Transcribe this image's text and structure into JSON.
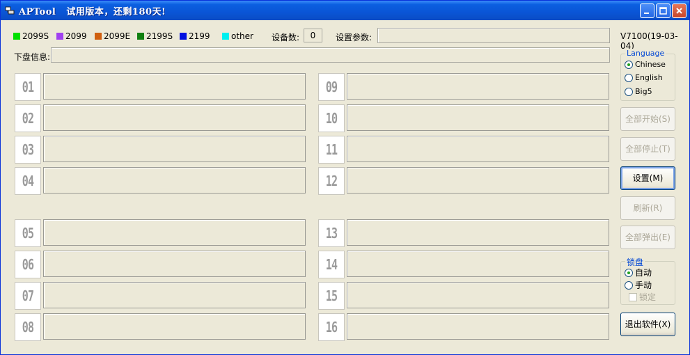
{
  "window": {
    "title": "APTool   试用版本，还剩180天!",
    "controls": {
      "minimize": "minimize-icon",
      "maximize": "maximize-icon",
      "close": "close-icon"
    }
  },
  "legend": [
    {
      "label": "2099S",
      "color": "#00e000"
    },
    {
      "label": "2099",
      "color": "#a040f0"
    },
    {
      "label": "2099E",
      "color": "#d06010"
    },
    {
      "label": "2199S",
      "color": "#108010"
    },
    {
      "label": "2199",
      "color": "#0010e0"
    },
    {
      "label": "other",
      "color": "#00f0f0"
    }
  ],
  "device_count_label": "设备数:",
  "device_count_value": "0",
  "device_params_label": "设置参数:",
  "version": "V7100(19-03-04)",
  "download_info_label": "下盘信息:",
  "slots_left": [
    "01",
    "02",
    "03",
    "04",
    "05",
    "06",
    "07",
    "08"
  ],
  "slots_right": [
    "09",
    "10",
    "11",
    "12",
    "13",
    "14",
    "15",
    "16"
  ],
  "language": {
    "title": "Language",
    "options": [
      "Chinese",
      "English",
      "Big5"
    ],
    "selected": "Chinese"
  },
  "buttons": {
    "start_all": "全部开始(S)",
    "stop_all": "全部停止(T)",
    "settings": "设置(M)",
    "refresh": "刷新(R)",
    "eject_all": "全部弹出(E)",
    "exit": "退出软件(X)"
  },
  "lock": {
    "title": "锁盘",
    "auto": "自动",
    "manual": "手动",
    "lock_label": "锁定",
    "selected": "自动"
  }
}
